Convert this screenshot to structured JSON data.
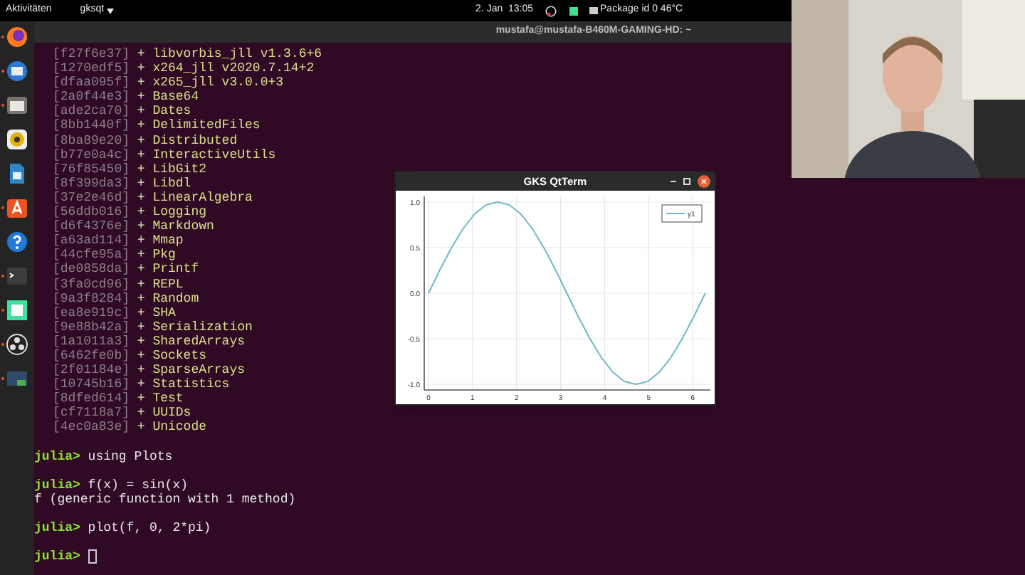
{
  "top_bar": {
    "activities": "Aktivitäten",
    "app_menu": "gksqt",
    "clock": "2. Jan  13:05",
    "sensor": "Package id 0 46°C"
  },
  "dock": [
    {
      "kind": "firefox",
      "running": true
    },
    {
      "kind": "mail",
      "running": true
    },
    {
      "kind": "files",
      "running": true
    },
    {
      "kind": "music",
      "running": false
    },
    {
      "kind": "writer",
      "running": false
    },
    {
      "kind": "store",
      "running": true
    },
    {
      "kind": "help",
      "running": false
    },
    {
      "kind": "terminal",
      "running": true
    },
    {
      "kind": "square",
      "running": true
    },
    {
      "kind": "obs",
      "running": true
    },
    {
      "kind": "display",
      "running": true
    }
  ],
  "terminal": {
    "title": "mustafa@mustafa-B460M-GAMING-HD: ~",
    "packages": [
      {
        "id": "[f27f6e37]",
        "plus": "+",
        "name": "libvorbis_jll v1.3.6+6"
      },
      {
        "id": "[1270edf5]",
        "plus": "+",
        "name": "x264_jll v2020.7.14+2"
      },
      {
        "id": "[dfaa095f]",
        "plus": "+",
        "name": "x265_jll v3.0.0+3"
      },
      {
        "id": "[2a0f44e3]",
        "plus": "+",
        "name": "Base64"
      },
      {
        "id": "[ade2ca70]",
        "plus": "+",
        "name": "Dates"
      },
      {
        "id": "[8bb1440f]",
        "plus": "+",
        "name": "DelimitedFiles"
      },
      {
        "id": "[8ba89e20]",
        "plus": "+",
        "name": "Distributed"
      },
      {
        "id": "[b77e0a4c]",
        "plus": "+",
        "name": "InteractiveUtils"
      },
      {
        "id": "[76f85450]",
        "plus": "+",
        "name": "LibGit2"
      },
      {
        "id": "[8f399da3]",
        "plus": "+",
        "name": "Libdl"
      },
      {
        "id": "[37e2e46d]",
        "plus": "+",
        "name": "LinearAlgebra"
      },
      {
        "id": "[56ddb016]",
        "plus": "+",
        "name": "Logging"
      },
      {
        "id": "[d6f4376e]",
        "plus": "+",
        "name": "Markdown"
      },
      {
        "id": "[a63ad114]",
        "plus": "+",
        "name": "Mmap"
      },
      {
        "id": "[44cfe95a]",
        "plus": "+",
        "name": "Pkg"
      },
      {
        "id": "[de0858da]",
        "plus": "+",
        "name": "Printf"
      },
      {
        "id": "[3fa0cd96]",
        "plus": "+",
        "name": "REPL"
      },
      {
        "id": "[9a3f8284]",
        "plus": "+",
        "name": "Random"
      },
      {
        "id": "[ea8e919c]",
        "plus": "+",
        "name": "SHA"
      },
      {
        "id": "[9e88b42a]",
        "plus": "+",
        "name": "Serialization"
      },
      {
        "id": "[1a1011a3]",
        "plus": "+",
        "name": "SharedArrays"
      },
      {
        "id": "[6462fe0b]",
        "plus": "+",
        "name": "Sockets"
      },
      {
        "id": "[2f01184e]",
        "plus": "+",
        "name": "SparseArrays"
      },
      {
        "id": "[10745b16]",
        "plus": "+",
        "name": "Statistics"
      },
      {
        "id": "[8dfed614]",
        "plus": "+",
        "name": "Test"
      },
      {
        "id": "[cf7118a7]",
        "plus": "+",
        "name": "UUIDs"
      },
      {
        "id": "[4ec0a83e]",
        "plus": "+",
        "name": "Unicode"
      }
    ],
    "repl": [
      {
        "kind": "gap"
      },
      {
        "kind": "input",
        "prompt": "julia>",
        "text": "using Plots"
      },
      {
        "kind": "gap"
      },
      {
        "kind": "input",
        "prompt": "julia>",
        "text": "f(x) = sin(x)"
      },
      {
        "kind": "output",
        "text": "f (generic function with 1 method)"
      },
      {
        "kind": "gap"
      },
      {
        "kind": "input",
        "prompt": "julia>",
        "text": "plot(f, 0, 2*pi)"
      },
      {
        "kind": "gap"
      },
      {
        "kind": "cursor",
        "prompt": "julia>"
      }
    ]
  },
  "plot_window": {
    "title": "GKS QtTerm",
    "chart_data": {
      "type": "line",
      "x": [
        0,
        0.262,
        0.524,
        0.785,
        1.047,
        1.309,
        1.571,
        1.833,
        2.094,
        2.356,
        2.618,
        2.88,
        3.142,
        3.403,
        3.665,
        3.927,
        4.189,
        4.451,
        4.712,
        4.974,
        5.236,
        5.498,
        5.76,
        6.021,
        6.283
      ],
      "series": [
        {
          "name": "y1",
          "color": "#6fb7c9",
          "values": [
            0,
            0.26,
            0.5,
            0.71,
            0.87,
            0.97,
            1,
            0.97,
            0.87,
            0.71,
            0.5,
            0.26,
            0,
            -0.26,
            -0.5,
            -0.71,
            -0.87,
            -0.97,
            -1,
            -0.97,
            -0.87,
            -0.71,
            -0.5,
            -0.26,
            0
          ]
        }
      ],
      "grid": true,
      "xlim": [
        0,
        6.4
      ],
      "ylim": [
        -1,
        1
      ],
      "xticks": [
        0,
        1,
        2,
        3,
        4,
        5,
        6
      ],
      "yticks": [
        {
          "value": 1,
          "label": "1.0"
        },
        {
          "value": 0.5,
          "label": "0.5"
        },
        {
          "value": 0,
          "label": "0.0"
        },
        {
          "value": -0.5,
          "label": "-0.5"
        },
        {
          "value": -1,
          "label": "-1.0"
        }
      ]
    }
  }
}
